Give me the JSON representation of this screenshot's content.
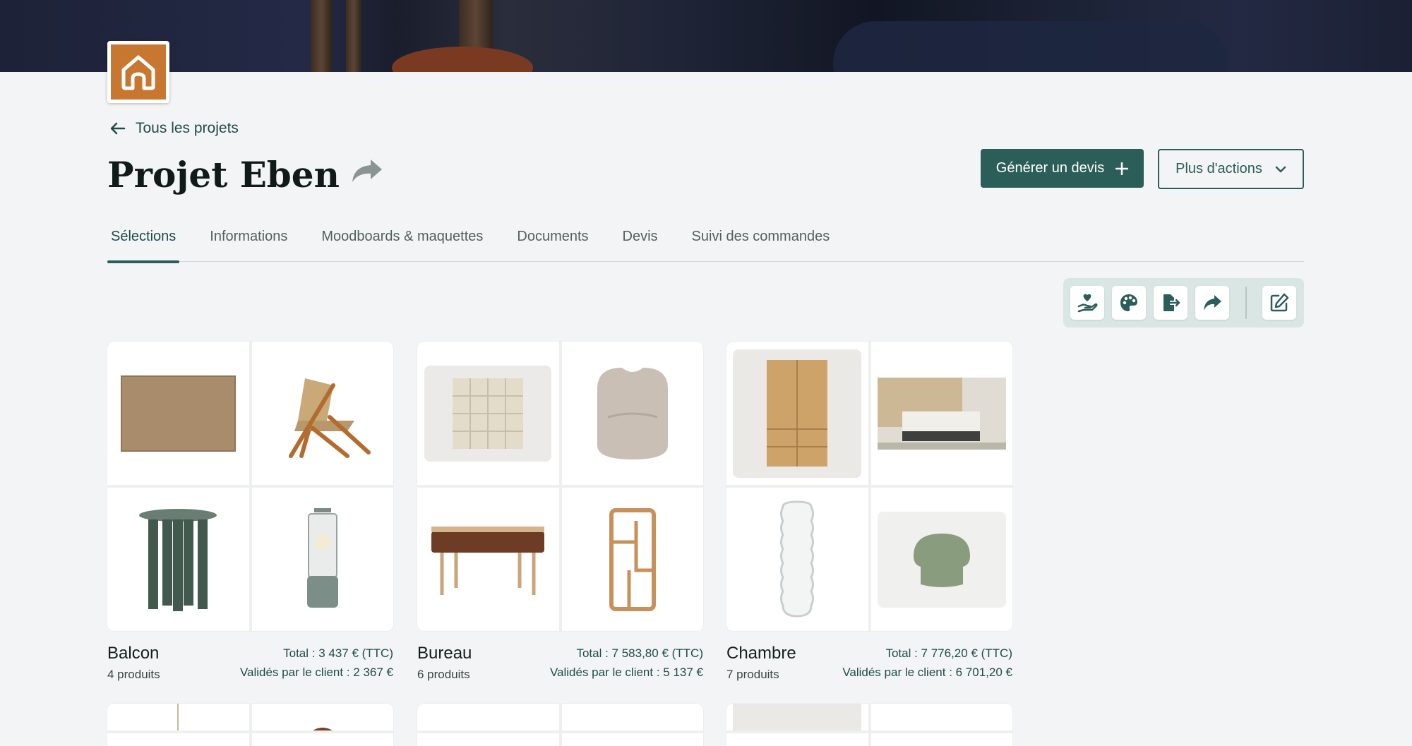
{
  "app": {
    "logo_icon": "house-icon",
    "accent": "#2b5e58",
    "brand_orange": "#c7772f"
  },
  "nav": {
    "back_label": "Tous les projets"
  },
  "project": {
    "title": "Projet Eben"
  },
  "actions": {
    "generate_quote": "Générer un devis",
    "more_actions": "Plus d'actions"
  },
  "tabs": [
    {
      "label": "Sélections",
      "active": true
    },
    {
      "label": "Informations"
    },
    {
      "label": "Moodboards & maquettes"
    },
    {
      "label": "Documents"
    },
    {
      "label": "Devis"
    },
    {
      "label": "Suivi des commandes"
    }
  ],
  "toolbar": {
    "icons": [
      "hand-heart-icon",
      "palette-icon",
      "export-icon",
      "share-icon",
      "edit-icon"
    ]
  },
  "selections": [
    {
      "name": "Balcon",
      "count": "4 produits",
      "total": "Total : 3 437 € (TTC)",
      "validated": "Validés par le client : 2 367 €",
      "items": [
        "rug",
        "rope-lounge-chair",
        "green-side-table",
        "table-lamp"
      ]
    },
    {
      "name": "Bureau",
      "count": "6 produits",
      "total": "Total : 7 583,80 € (TTC)",
      "validated": "Validés par le client : 5 137 €",
      "items": [
        "checker-rug",
        "boucle-armchair",
        "wood-desk",
        "wood-shelf"
      ]
    },
    {
      "name": "Chambre",
      "count": "7 produits",
      "total": "Total : 7 776,20 € (TTC)",
      "validated": "Validés par le client : 6 701,20 €",
      "items": [
        "oak-wardrobe",
        "bedroom-scene",
        "wavy-mirror",
        "green-pouf"
      ]
    }
  ]
}
